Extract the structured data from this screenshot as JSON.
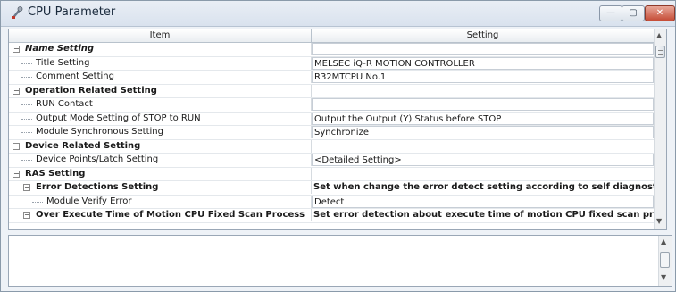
{
  "window": {
    "title": "CPU Parameter",
    "min_glyph": "—",
    "max_glyph": "▢",
    "close_glyph": "✕"
  },
  "grid": {
    "columns": {
      "item": "Item",
      "setting": "Setting"
    },
    "rows": [
      {
        "item": "Name Setting",
        "setting": "",
        "level": 0,
        "type": "group",
        "italic": true
      },
      {
        "item": "Title Setting",
        "setting": "MELSEC iQ-R MOTION CONTROLLER",
        "level": 1,
        "type": "leaf"
      },
      {
        "item": "Comment Setting",
        "setting": "R32MTCPU No.1",
        "level": 1,
        "type": "leaf"
      },
      {
        "item": "Operation Related Setting",
        "setting": "",
        "level": 0,
        "type": "group"
      },
      {
        "item": "RUN Contact",
        "setting": "",
        "level": 1,
        "type": "leaf"
      },
      {
        "item": "Output Mode Setting of STOP to RUN",
        "setting": "Output the Output (Y) Status before STOP",
        "level": 1,
        "type": "leaf"
      },
      {
        "item": "Module Synchronous Setting",
        "setting": "Synchronize",
        "level": 1,
        "type": "leaf"
      },
      {
        "item": "Device Related Setting",
        "setting": "",
        "level": 0,
        "type": "group"
      },
      {
        "item": "Device Points/Latch Setting",
        "setting": "<Detailed Setting>",
        "level": 1,
        "type": "leaf"
      },
      {
        "item": "RAS Setting",
        "setting": "",
        "level": 0,
        "type": "group"
      },
      {
        "item": "Error Detections Setting",
        "setting": "Set when change the error detect setting according to self diagnostics",
        "level": 1,
        "type": "subgroup"
      },
      {
        "item": "Module Verify Error",
        "setting": "Detect",
        "level": 2,
        "type": "leaf"
      },
      {
        "item": "Over Execute Time of Motion CPU Fixed Scan Process",
        "setting": "Set error detection about execute time of motion CPU fixed scan proce...",
        "level": 1,
        "type": "subgroup"
      }
    ]
  },
  "description": {
    "text": ""
  },
  "scroll": {
    "up_glyph": "▲",
    "down_glyph": "▼"
  }
}
